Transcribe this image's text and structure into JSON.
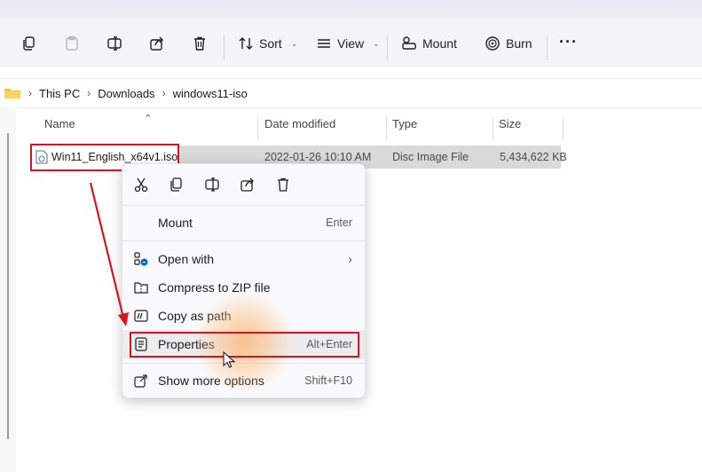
{
  "toolbar": {
    "sort_label": "Sort",
    "view_label": "View",
    "mount_label": "Mount",
    "burn_label": "Burn",
    "more_label": "···"
  },
  "breadcrumb": [
    "This PC",
    "Downloads",
    "windows11-iso"
  ],
  "columns": {
    "name": "Name",
    "date": "Date modified",
    "type": "Type",
    "size": "Size"
  },
  "file": {
    "name": "Win11_English_x64v1.iso",
    "date": "2022-01-26 10:10 AM",
    "type": "Disc Image File",
    "size": "5,434,622 KB"
  },
  "context_menu": {
    "mount": {
      "label": "Mount",
      "shortcut": "Enter"
    },
    "open_with": {
      "label": "Open with"
    },
    "compress": {
      "label": "Compress to ZIP file"
    },
    "copy_path": {
      "label": "Copy as path"
    },
    "properties": {
      "label": "Properties",
      "shortcut": "Alt+Enter"
    },
    "more_options": {
      "label": "Show more options",
      "shortcut": "Shift+F10"
    }
  },
  "colors": {
    "accent": "#0067c0",
    "highlight_red": "#d6141b",
    "folder_yellow": "#f4c542"
  }
}
